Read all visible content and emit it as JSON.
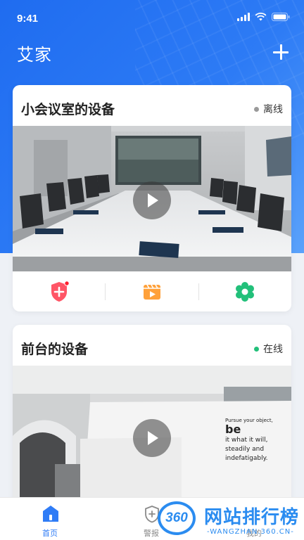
{
  "status_bar": {
    "time": "9:41"
  },
  "header": {
    "title": "艾家",
    "add_icon": "plus-icon"
  },
  "devices": [
    {
      "name": "小会议室的设备",
      "status": "离线",
      "status_color": "#9a9a9a"
    },
    {
      "name": "前台的设备",
      "status": "在线",
      "status_color": "#22c07a"
    }
  ],
  "actions": [
    {
      "icon": "security-shield-icon",
      "color": "#ff4b5c"
    },
    {
      "icon": "video-playback-icon",
      "color": "#ffa13a"
    },
    {
      "icon": "settings-gear-icon",
      "color": "#22c07a"
    }
  ],
  "front_desk_wall": [
    "Pursue your object,",
    "be",
    "it what it will,",
    "steadily and",
    "indefatigably."
  ],
  "tabbar": {
    "tabs": [
      {
        "label": "首页",
        "active": true
      },
      {
        "label": "警报",
        "active": false
      },
      {
        "label": "我的",
        "active": false
      }
    ],
    "active_color": "#2f7cf6",
    "inactive_color": "#8a8a8a"
  },
  "watermark": {
    "logo": "360",
    "text": "网站排行榜",
    "url": "-WANGZHAN.360.CN-"
  }
}
